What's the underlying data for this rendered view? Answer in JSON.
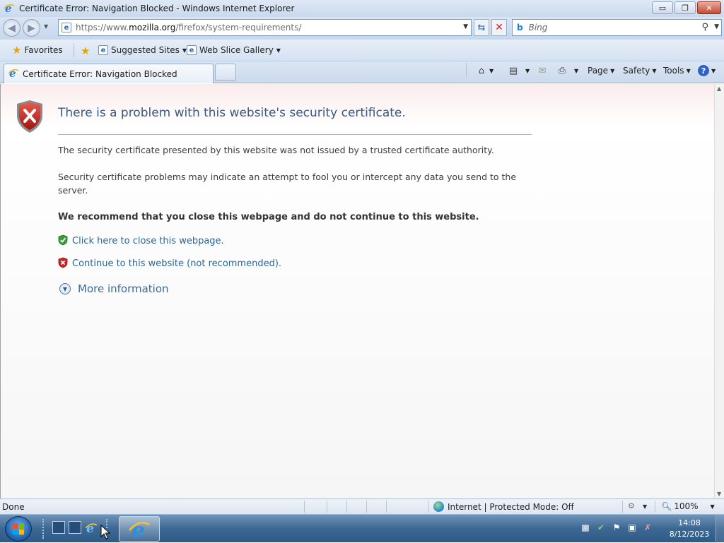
{
  "window": {
    "title": "Certificate Error: Navigation Blocked - Windows Internet Explorer",
    "min_glyph": "▭",
    "max_glyph": "❐",
    "close_glyph": "✕"
  },
  "nav": {
    "url_prefix": "https://www.",
    "url_domain": "mozilla.org",
    "url_path": "/firefox/system-requirements/",
    "search_placeholder": "Bing"
  },
  "favorites_bar": {
    "favorites_label": "Favorites",
    "items": [
      {
        "label": "Suggested Sites"
      },
      {
        "label": "Web Slice Gallery"
      }
    ]
  },
  "tab": {
    "label": "Certificate Error: Navigation Blocked"
  },
  "commands": {
    "page": "Page",
    "safety": "Safety",
    "tools": "Tools",
    "help": "?"
  },
  "error_page": {
    "title": "There is a problem with this website's security certificate.",
    "para1": "The security certificate presented by this website was not issued by a trusted certificate authority.",
    "para2": "Security certificate problems may indicate an attempt to fool you or intercept any data you send to the server.",
    "recommendation": "We recommend that you close this webpage and do not continue to this website.",
    "close_link": "Click here to close this webpage.",
    "continue_link": "Continue to this website (not recommended).",
    "more_info": "More information"
  },
  "status": {
    "text": "Done",
    "zone": "Internet | Protected Mode: Off",
    "zoom": "100%"
  },
  "taskbar": {
    "time": "14:08",
    "date": "8/12/2023"
  },
  "colors": {
    "accent": "#2b6594",
    "title_text": "#3a5a80",
    "error_red": "#c62828",
    "safe_green": "#3a9b3a"
  }
}
